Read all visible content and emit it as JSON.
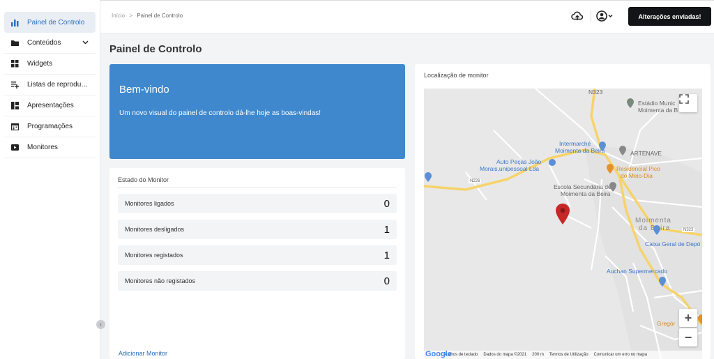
{
  "sidebar": {
    "items": [
      {
        "label": "Painel de Controlo",
        "icon": "bar-chart-icon",
        "active": true
      },
      {
        "label": "Conteúdos",
        "icon": "folder-icon",
        "chevron": true
      },
      {
        "label": "Widgets",
        "icon": "widgets-icon"
      },
      {
        "label": "Listas de reprodução",
        "icon": "playlist-add-icon"
      },
      {
        "label": "Apresentações",
        "icon": "layout-icon"
      },
      {
        "label": "Programações",
        "icon": "calendar-icon"
      },
      {
        "label": "Monitores",
        "icon": "play-icon"
      }
    ],
    "collapse_glyph": "‹"
  },
  "breadcrumb": {
    "home": "Início",
    "separator": ">",
    "current": "Painel de Controlo"
  },
  "topbar": {
    "alert_button": "Alterações enviadas!",
    "upload_icon": "cloud-upload-icon",
    "user_icon": "account-circle-icon"
  },
  "page_title": "Painel de Controlo",
  "welcome": {
    "title": "Bem-vindo",
    "message": "Um novo visual do painel de controlo dá-lhe hoje as boas-vindas!"
  },
  "status": {
    "title": "Estado do Monitor",
    "rows": [
      {
        "label": "Monitores ligados",
        "value": "0"
      },
      {
        "label": "Monitores desligados",
        "value": "1"
      },
      {
        "label": "Monitores registados",
        "value": "1"
      },
      {
        "label": "Monitores não registados",
        "value": "0"
      }
    ],
    "add_link": "Adicionar Monitor"
  },
  "map": {
    "title": "Localização de monitor",
    "labels": {
      "estadio": "Estádio Munic",
      "estadio2": "Moimenta da B",
      "intermarche": "Intermarché",
      "intermarche2": "Moimenta da Beira",
      "artenave": "ARTENAVE",
      "autopecas": "Auto Peças João",
      "autopecas2": "Morais,unipessoal Lda",
      "residencial": "Residencial Pico",
      "residencial2": "do Meio-Dia",
      "escola": "Escola Secundária de",
      "escola2": "Moimenta da Beira",
      "town": "Moimenta",
      "town2": "da Beira",
      "caixa": "Caixa Geral de Depó",
      "auchan": "Auchan Supermercado",
      "gregorio": "Gregór",
      "n226": "N226",
      "n323": "N323",
      "n323b": "N323"
    },
    "footer": {
      "google": "Google",
      "shortcuts": "Atalhos de teclado",
      "mapdata": "Dados do mapa ©2021",
      "scale": "200 m",
      "terms": "Termos de Utilização",
      "report": "Comunicar um erro no mapa"
    },
    "zoom_in": "+",
    "zoom_out": "−"
  },
  "colors": {
    "accent": "#3f88cd",
    "dark_button": "#121417",
    "active_text": "#2a6ebd",
    "pin": "#c62828"
  }
}
